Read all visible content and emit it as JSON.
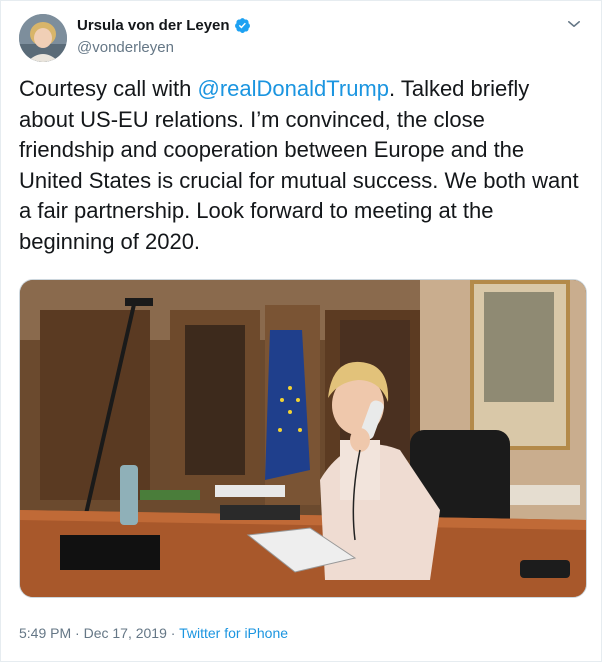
{
  "user": {
    "display_name": "Ursula von der Leyen",
    "handle": "@vonderleyen",
    "verified_icon": "verified-badge-icon",
    "avatar_icon": "avatar"
  },
  "tweet": {
    "text_before": "Courtesy call with ",
    "mention": "@realDonaldTrump",
    "text_after": ". Talked briefly about US-EU relations. I’m convinced, the close friendship and cooperation between Europe and the United States is crucial for mutual success. We both want a fair partnership. Look forward to meeting at the beginning of 2020."
  },
  "meta": {
    "time": "5:49 PM",
    "separator1": " · ",
    "date": "Dec 17, 2019",
    "separator2": " · ",
    "source": "Twitter for iPhone"
  },
  "colors": {
    "accent": "#1b95e0",
    "secondary_text": "#657786",
    "primary_text": "#14171a"
  }
}
